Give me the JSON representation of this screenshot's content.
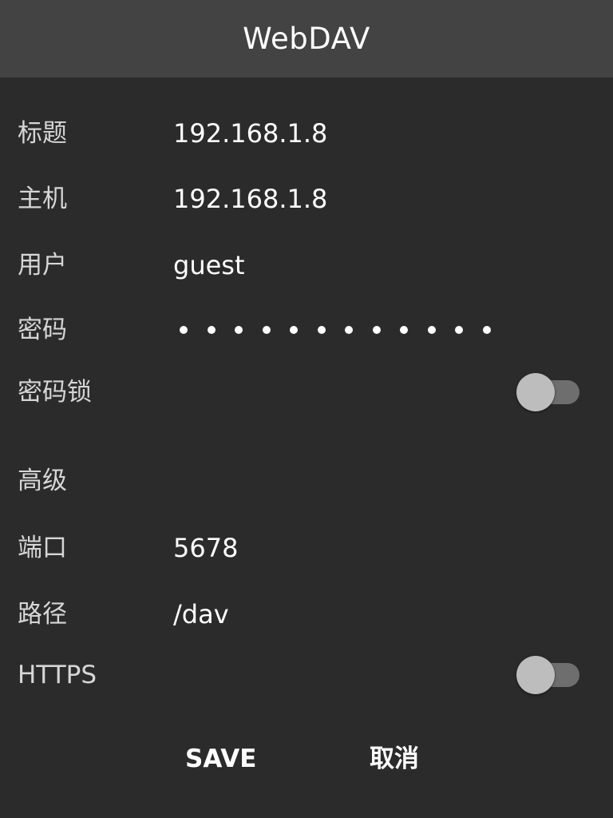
{
  "header": {
    "title": "WebDAV"
  },
  "form": {
    "title": {
      "label": "标题",
      "value": "192.168.1.8"
    },
    "host": {
      "label": "主机",
      "value": "192.168.1.8"
    },
    "user": {
      "label": "用户",
      "value": "guest"
    },
    "password": {
      "label": "密码",
      "masked_length": 12
    },
    "password_lock": {
      "label": "密码锁",
      "on": false
    }
  },
  "advanced": {
    "section_label": "高级",
    "port": {
      "label": "端口",
      "value": "5678"
    },
    "path": {
      "label": "路径",
      "value": "/dav"
    },
    "https": {
      "label": "HTTPS",
      "on": false
    }
  },
  "actions": {
    "save_label": "SAVE",
    "cancel_label": "取消"
  },
  "colors": {
    "background": "#2b2b2b",
    "titlebar": "#434343",
    "toggle_track": "#6e6e6e",
    "toggle_knob": "#bdbdbd"
  }
}
